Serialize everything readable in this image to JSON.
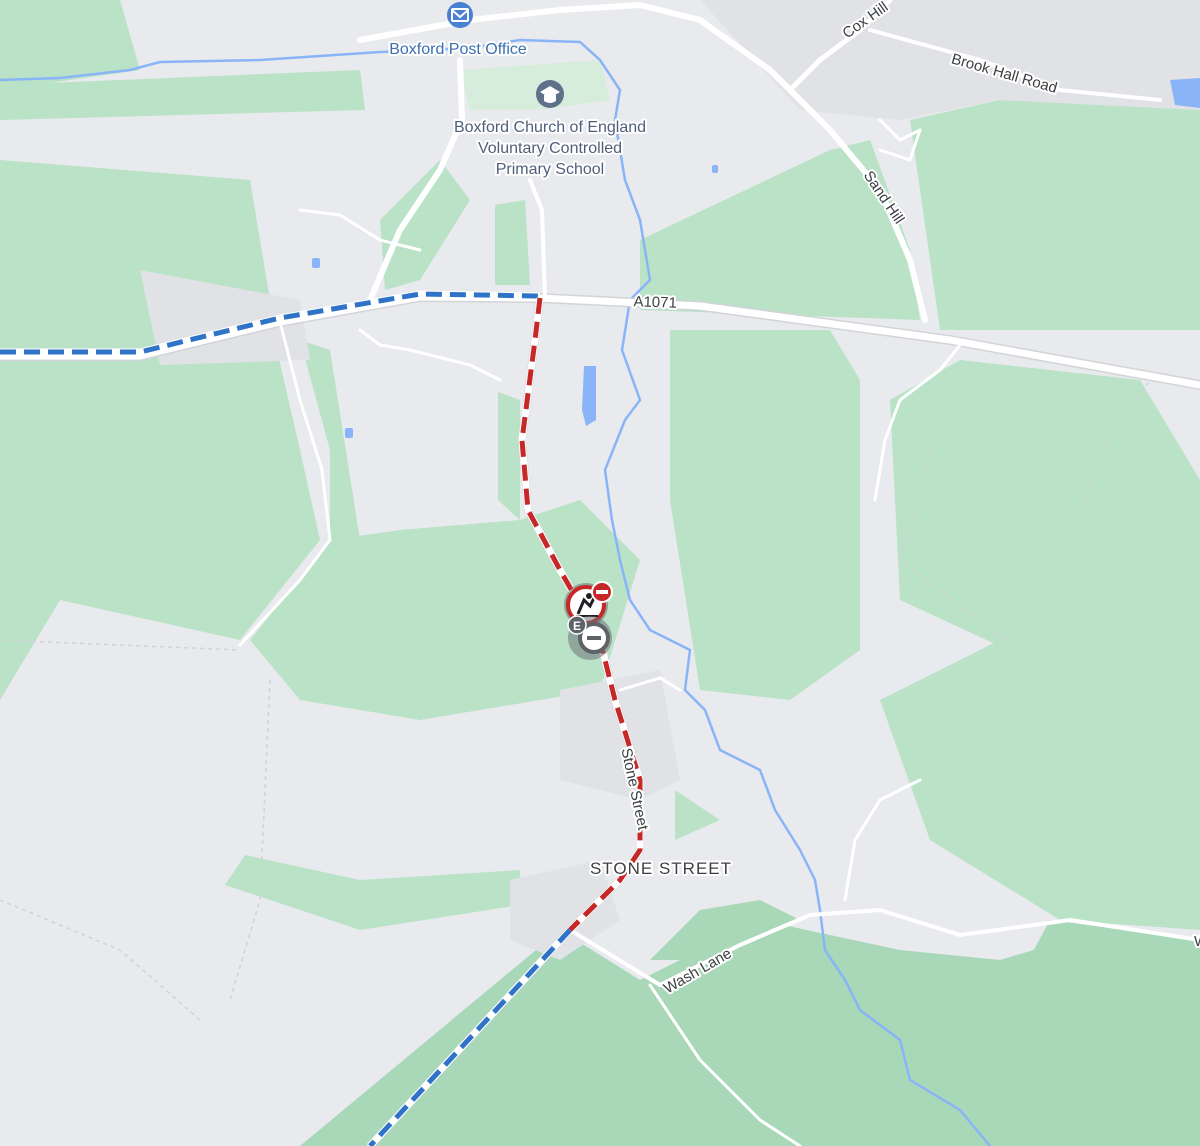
{
  "map": {
    "colors": {
      "land": "#e9eaed",
      "green_light": "#b9e2c7",
      "green_dark": "#a8d8b8",
      "road": "#ffffff",
      "water": "#8ab4f8",
      "route_red": "#c62828",
      "route_blue": "#2f73c8",
      "poi_blue": "#4a80d4",
      "school_grey": "#5f7089"
    },
    "pois": {
      "post_office": {
        "name": "Boxford Post Office",
        "icon": "mail-icon"
      },
      "school": {
        "name_line1": "Boxford Church of England",
        "name_line2": "Voluntary Controlled",
        "name_line3": "Primary School",
        "icon": "graduation-cap-icon"
      }
    },
    "roads": {
      "a1071": "A1071",
      "cox_hill": "Cox Hill",
      "brook_hall_road": "Brook Hall Road",
      "sand_hill": "Sand Hill",
      "stone_street": "Stone Street",
      "wash_lane": "Wash Lane",
      "edge_label": "W"
    },
    "places": {
      "stone_street": "STONE STREET"
    },
    "incidents": {
      "road_closure": {
        "icon": "road-closed-icon"
      },
      "roadworks": {
        "icon": "roadworks-icon"
      },
      "closure_secondary": {
        "icon": "closure-e-icon",
        "letter": "E"
      }
    }
  }
}
